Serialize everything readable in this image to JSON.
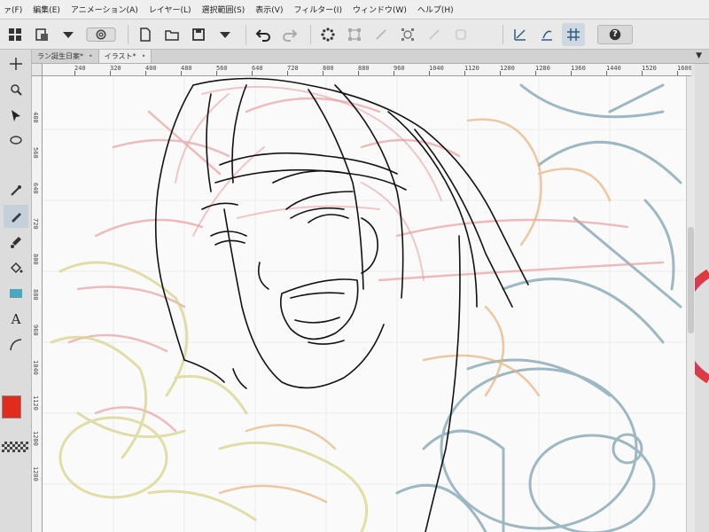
{
  "menu": {
    "items": [
      "ァ(F)",
      "編集(E)",
      "アニメーション(A)",
      "レイヤー(L)",
      "選択範囲(S)",
      "表示(V)",
      "フィルター(I)",
      "ウィンドウ(W)",
      "ヘルプ(H)"
    ]
  },
  "toolbar": {
    "icons": [
      "grid-icon",
      "save-file-icon",
      "dropdown-icon",
      "clip-logo-icon",
      "new-file-icon",
      "open-folder-icon",
      "save-icon",
      "dropdown-icon",
      "undo-icon",
      "redo-icon",
      "busy-spinner-icon",
      "transform-icon",
      "crop-icon",
      "select-icon",
      "snap-ruler-icon",
      "snap-special-ruler-icon",
      "snap-grid-icon"
    ],
    "help_label": "?"
  },
  "tabs": [
    {
      "label": "ラン誕生日案*",
      "close": "•"
    },
    {
      "label": "イラスト*",
      "close": "•"
    }
  ],
  "tab_menu": "▼",
  "ruler": {
    "top_ticks": [
      "240",
      "320",
      "400",
      "480",
      "560",
      "640",
      "720",
      "800",
      "880",
      "960",
      "1040",
      "1120",
      "1200",
      "1280",
      "1360",
      "1440",
      "1520",
      "1600"
    ],
    "left_ticks": [
      "480",
      "560",
      "640",
      "720",
      "800",
      "880",
      "960",
      "1040",
      "1120",
      "1200",
      "1280"
    ]
  },
  "tools": {
    "text_tool_glyph": "A",
    "main_color": "#e32b1c"
  },
  "colors": {
    "sketch_red": "#e89a9e",
    "sketch_blue": "#7ea3b0",
    "sketch_yellow": "#d8d48a",
    "sketch_orange": "#e8b27a",
    "lineart": "#111111"
  }
}
